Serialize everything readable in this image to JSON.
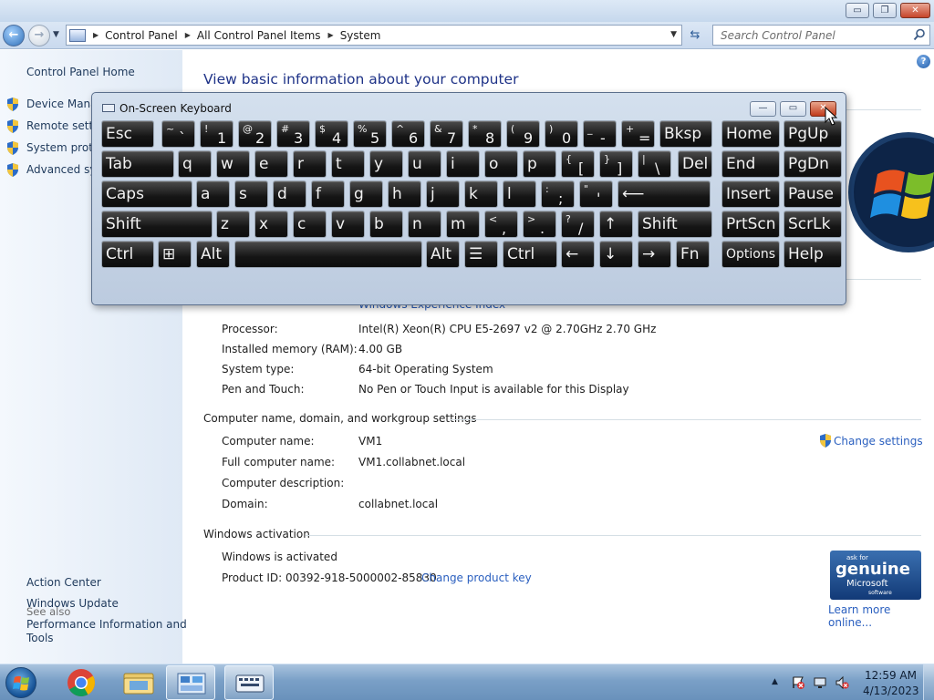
{
  "window": {
    "caption_buttons": {
      "minimize": "▭",
      "maximize": "❐",
      "close": "✕"
    }
  },
  "navbar": {
    "back_icon": "back-arrow-icon",
    "forward_icon": "forward-arrow-icon",
    "breadcrumbs": [
      "Control Panel",
      "All Control Panel Items",
      "System"
    ],
    "search_placeholder": "Search Control Panel"
  },
  "sidebar": {
    "home": "Control Panel Home",
    "tasks": [
      {
        "label": "Device Manager",
        "icon": "shield-icon"
      },
      {
        "label": "Remote settings",
        "icon": "shield-icon"
      },
      {
        "label": "System protection",
        "icon": "shield-icon"
      },
      {
        "label": "Advanced system settings",
        "icon": "shield-icon"
      }
    ],
    "see_also_heading": "See also",
    "see_also": [
      "Action Center",
      "Windows Update",
      "Performance Information and",
      "Tools"
    ]
  },
  "main": {
    "title": "View basic information about your computer",
    "wei_partial": "Windows Experience Index",
    "system_rows": [
      {
        "label": "Processor:",
        "value": "Intel(R) Xeon(R) CPU E5-2697 v2 @ 2.70GHz   2.70 GHz"
      },
      {
        "label": "Installed memory (RAM):",
        "value": "4.00 GB"
      },
      {
        "label": "System type:",
        "value": "64-bit Operating System"
      },
      {
        "label": "Pen and Touch:",
        "value": "No Pen or Touch Input is available for this Display"
      }
    ],
    "name_section": {
      "heading": "Computer name, domain, and workgroup settings",
      "change_link": "Change settings",
      "rows": [
        {
          "label": "Computer name:",
          "value": "VM1"
        },
        {
          "label": "Full computer name:",
          "value": "VM1.collabnet.local"
        },
        {
          "label": "Computer description:",
          "value": ""
        },
        {
          "label": "Domain:",
          "value": "collabnet.local"
        }
      ]
    },
    "activation": {
      "heading": "Windows activation",
      "status": "Windows is activated",
      "product_id": "Product ID: 00392-918-5000002-85830",
      "change_key": "Change product key",
      "genuine": {
        "ask": "ask for",
        "main": "genuine",
        "ms": "Microsoft",
        "sw": "software"
      },
      "learn_more": "Learn more online..."
    }
  },
  "osk": {
    "title": "On-Screen Keyboard",
    "caption_buttons": {
      "minimize": "—",
      "maximize": "▭",
      "close": "✕"
    },
    "rows": [
      [
        {
          "t": "Esc"
        },
        {
          "top": "~",
          "bot": "`"
        },
        {
          "top": "!",
          "bot": "1"
        },
        {
          "top": "@",
          "bot": "2"
        },
        {
          "top": "#",
          "bot": "3"
        },
        {
          "top": "$",
          "bot": "4"
        },
        {
          "top": "%",
          "bot": "5"
        },
        {
          "top": "^",
          "bot": "6"
        },
        {
          "top": "&",
          "bot": "7"
        },
        {
          "top": "*",
          "bot": "8"
        },
        {
          "top": "(",
          "bot": "9"
        },
        {
          "top": ")",
          "bot": "0"
        },
        {
          "top": "_",
          "bot": "-"
        },
        {
          "top": "+",
          "bot": "="
        },
        {
          "t": "Bksp"
        },
        {
          "t": "Home"
        },
        {
          "t": "PgUp"
        }
      ],
      [
        {
          "t": "Tab"
        },
        {
          "t": "q"
        },
        {
          "t": "w"
        },
        {
          "t": "e"
        },
        {
          "t": "r"
        },
        {
          "t": "t"
        },
        {
          "t": "y"
        },
        {
          "t": "u"
        },
        {
          "t": "i"
        },
        {
          "t": "o"
        },
        {
          "t": "p"
        },
        {
          "top": "{",
          "bot": "["
        },
        {
          "top": "}",
          "bot": "]"
        },
        {
          "top": "|",
          "bot": "\\"
        },
        {
          "t": "Del"
        },
        {
          "t": "End"
        },
        {
          "t": "PgDn"
        }
      ],
      [
        {
          "t": "Caps"
        },
        {
          "t": "a"
        },
        {
          "t": "s"
        },
        {
          "t": "d"
        },
        {
          "t": "f"
        },
        {
          "t": "g"
        },
        {
          "t": "h"
        },
        {
          "t": "j"
        },
        {
          "t": "k"
        },
        {
          "t": "l"
        },
        {
          "top": ":",
          "bot": ";"
        },
        {
          "top": "\"",
          "bot": "'"
        },
        {
          "t": "⟵"
        },
        {
          "t": "Insert"
        },
        {
          "t": "Pause"
        }
      ],
      [
        {
          "t": "Shift"
        },
        {
          "t": "z"
        },
        {
          "t": "x"
        },
        {
          "t": "c"
        },
        {
          "t": "v"
        },
        {
          "t": "b"
        },
        {
          "t": "n"
        },
        {
          "t": "m"
        },
        {
          "top": "<",
          "bot": ","
        },
        {
          "top": ">",
          "bot": "."
        },
        {
          "top": "?",
          "bot": "/"
        },
        {
          "t": "↑"
        },
        {
          "t": "Shift"
        },
        {
          "t": "PrtScn"
        },
        {
          "t": "ScrLk"
        }
      ],
      [
        {
          "t": "Ctrl"
        },
        {
          "t": "⊞"
        },
        {
          "t": "Alt"
        },
        {
          "t": ""
        },
        {
          "t": "Alt"
        },
        {
          "t": "☰"
        },
        {
          "t": "Ctrl"
        },
        {
          "t": "←"
        },
        {
          "t": "↓"
        },
        {
          "t": "→"
        },
        {
          "t": "Fn"
        },
        {
          "t": "Options"
        },
        {
          "t": "Help"
        }
      ]
    ]
  },
  "taskbar": {
    "items": [
      "chrome-icon",
      "explorer-icon",
      "control-panel-icon",
      "on-screen-keyboard-icon"
    ],
    "tray_up": "▲",
    "tray_icons": [
      "action-center-icon",
      "network-icon",
      "volume-muted-icon"
    ],
    "time": "12:59 AM",
    "date": "4/13/2023"
  }
}
